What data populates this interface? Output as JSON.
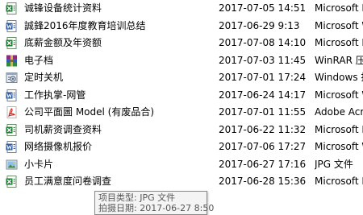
{
  "files": [
    {
      "name": "诚锋设备统计资料",
      "date": "2017-07-05 14:51",
      "type": "Microsoft E",
      "icon": "excel-file-icon"
    },
    {
      "name": "誠鋒2016年度教育培训总结",
      "date": "2017-06-29 9:13",
      "type": "Microsoft W",
      "icon": "word-file-icon"
    },
    {
      "name": "底薪金额及年资额",
      "date": "2017-07-08 14:10",
      "type": "Microsoft E",
      "icon": "excel-file-icon"
    },
    {
      "name": "电子档",
      "date": "2017-07-03 11:45",
      "type": "WinRAR 压缩",
      "icon": "winrar-archive-icon"
    },
    {
      "name": "定时关机",
      "date": "2017-07-01 17:24",
      "type": "Windows 批",
      "icon": "batch-file-icon"
    },
    {
      "name": "工作执掌-网管",
      "date": "2017-06-24 14:17",
      "type": "Microsoft W",
      "icon": "word-file-icon"
    },
    {
      "name": "公司平面圖 Model (有废品合)",
      "date": "2017-07-01 11:55",
      "type": "Adobe Acro",
      "icon": "pdf-file-icon"
    },
    {
      "name": "司机薪资调查资料",
      "date": "2017-06-22 11:32",
      "type": "Microsoft E",
      "icon": "excel-file-icon"
    },
    {
      "name": "网络摄像机报价",
      "date": "2017-07-06 17:27",
      "type": "Microsoft W",
      "icon": "word-file-icon"
    },
    {
      "name": "小卡片",
      "date": "2017-06-27 17:16",
      "type": "JPG 文件",
      "icon": "jpg-image-icon"
    },
    {
      "name": "员工满意度问卷调查",
      "date": "2017-06-28 15:36",
      "type": "Microsoft E",
      "icon": "excel-file-icon"
    }
  ],
  "tooltip": {
    "line1": "项目类型: JPG 文件",
    "line2": "拍摄日期: 2017-06-27 8:50"
  }
}
